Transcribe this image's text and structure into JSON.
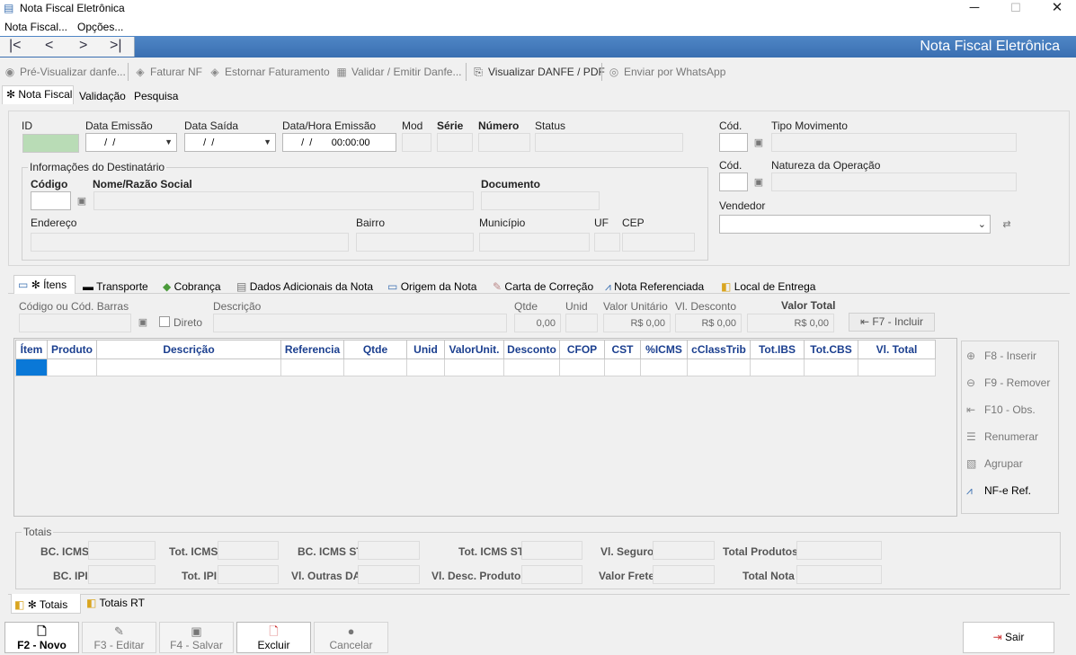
{
  "window": {
    "title": "Nota Fiscal Eletrônica",
    "minimize": "─",
    "maximize": "☐",
    "close": "✕"
  },
  "menu": {
    "items": [
      "Nota Fiscal...",
      "Opções..."
    ]
  },
  "nav": {
    "first": "|<",
    "prev": "<",
    "next": ">",
    "last": ">|",
    "title": "Nota Fiscal Eletrônica"
  },
  "toolbar": {
    "items": [
      "Pré-Visualizar danfe...",
      "Faturar NF",
      "Estornar Faturamento",
      "Validar / Emitir Danfe...",
      "Visualizar DANFE / PDF",
      "Enviar por WhatsApp"
    ]
  },
  "tabs": {
    "items": [
      "✻ Nota Fiscal",
      "Validação",
      "Pesquisa"
    ]
  },
  "header": {
    "id_label": "ID",
    "data_emissao": {
      "label": "Data Emissão",
      "value": "  /  /"
    },
    "data_saida": {
      "label": "Data Saída",
      "value": "  /  /"
    },
    "data_hora_emissao": {
      "label": "Data/Hora Emissão",
      "value": "  /  /       00:00:00"
    },
    "mod_label": "Mod",
    "serie_label": "Série",
    "numero_label": "Número",
    "status_label": "Status",
    "cod1_label": "Cód.",
    "tipo_movimento_label": "Tipo Movimento",
    "cod2_label": "Cód.",
    "natureza_label": "Natureza da Operação",
    "vendedor_label": "Vendedor"
  },
  "destinatario": {
    "title": "Informações do Destinatário",
    "codigo": "Código",
    "nome": "Nome/Razão Social",
    "documento": "Documento",
    "endereco": "Endereço",
    "bairro": "Bairro",
    "municipio": "Município",
    "uf": "UF",
    "cep": "CEP"
  },
  "subtabs": {
    "items": [
      "✻ Ítens",
      "Transporte",
      "Cobrança",
      "Dados Adicionais da Nota",
      "Origem da Nota",
      "Carta de Correção",
      "Nota Referenciada",
      "Local de Entrega"
    ]
  },
  "item_entry": {
    "codigo_label": "Código ou Cód. Barras",
    "direto_label": "Direto",
    "descricao_label": "Descrição",
    "qtde_label": "Qtde",
    "qtde_value": "0,00",
    "unid_label": "Unid",
    "valor_unit_label": "Valor Unitário",
    "valor_unit_value": "R$ 0,00",
    "desconto_label": "Vl. Desconto",
    "desconto_value": "R$ 0,00",
    "valor_total_label": "Valor Total",
    "valor_total_value": "R$ 0,00",
    "incluir_button": "F7 - Incluir"
  },
  "grid": {
    "columns": [
      "Ítem",
      "Produto",
      "Descrição",
      "Referencia",
      "Qtde",
      "Unid",
      "ValorUnit.",
      "Desconto",
      "CFOP",
      "CST",
      "%ICMS",
      "cClassTrib",
      "Tot.IBS",
      "Tot.CBS",
      "Vl. Total"
    ]
  },
  "side": {
    "items": [
      "F8 - Inserir",
      "F9 - Remover",
      "F10 - Obs.",
      "Renumerar",
      "Agrupar",
      "NF-e Ref."
    ]
  },
  "totais": {
    "title": "Totais",
    "labels": [
      "BC. ICMS",
      "Tot. ICMS",
      "BC. ICMS ST",
      "Tot. ICMS ST",
      "Vl. Seguro",
      "Total Produtos",
      "BC. IPI",
      "Tot. IPI",
      "Vl. Outras DA",
      "Vl. Desc. Produtos",
      "Valor Frete",
      "Total Nota"
    ]
  },
  "bottom_tabs": {
    "items": [
      "✻ Totais",
      "Totais RT"
    ]
  },
  "buttons": {
    "novo": "F2 - Novo",
    "editar": "F3 - Editar",
    "salvar": "F4 - Salvar",
    "excluir": "Excluir",
    "cancelar": "Cancelar",
    "sair": "Sair"
  }
}
